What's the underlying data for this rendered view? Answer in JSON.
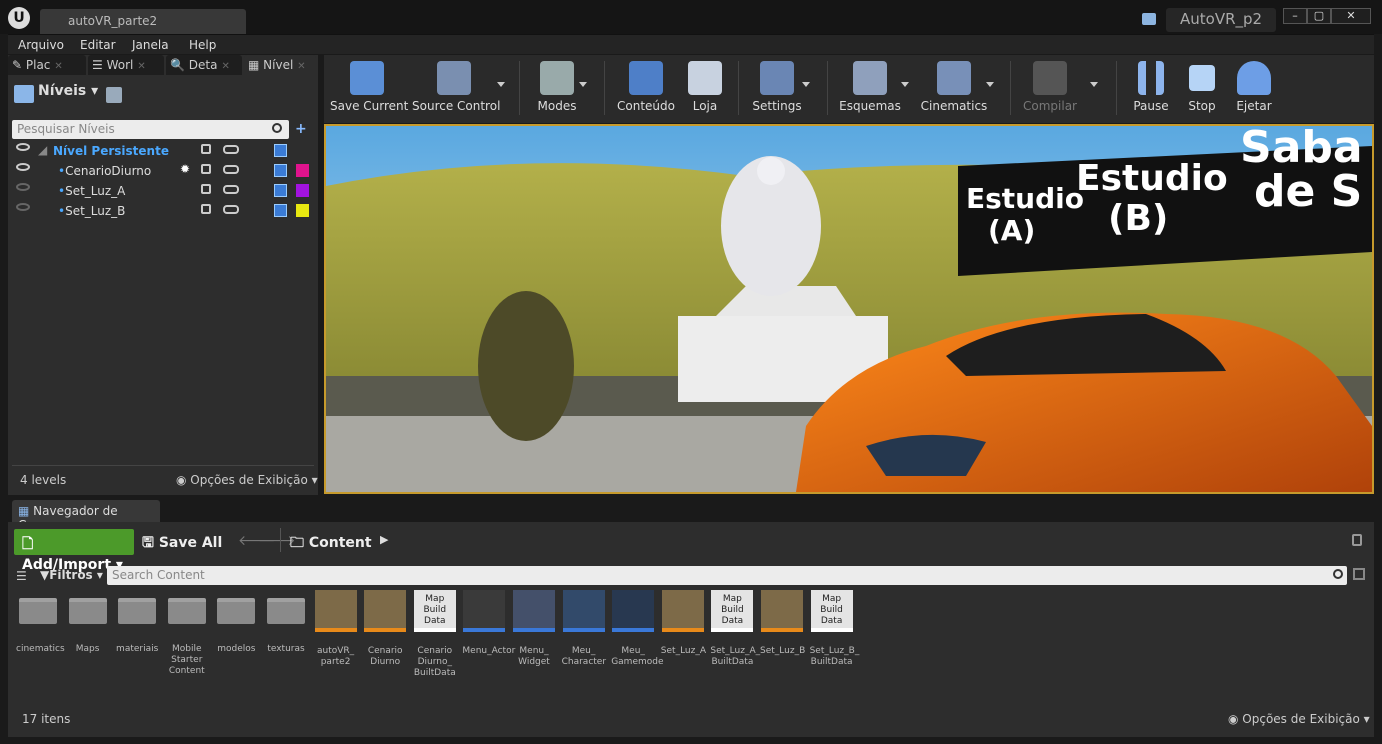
{
  "window": {
    "tab_title": "autoVR_parte2",
    "project_name": "AutoVR_p2"
  },
  "menu": [
    "Arquivo",
    "Editar",
    "Janela",
    "Help"
  ],
  "left_tabs": [
    "Plac",
    "Worl",
    "Deta",
    "Nível"
  ],
  "levels": {
    "header": "Níveis",
    "search_placeholder": "Pesquisar Níveis",
    "items": [
      {
        "name": "Nível Persistente",
        "color": ""
      },
      {
        "name": "CenarioDiurno",
        "color": "#e0138d"
      },
      {
        "name": "Set_Luz_A",
        "color": "#a213e0"
      },
      {
        "name": "Set_Luz_B",
        "color": "#e8e811"
      }
    ],
    "count": "4 levels",
    "view_options": "Opções de Exibição"
  },
  "toolbar": [
    "Save Current",
    "Source Control",
    "Modes",
    "Conteúdo",
    "Loja",
    "Settings",
    "Esquemas",
    "Cinematics",
    "Compilar",
    "Pause",
    "Stop",
    "Ejetar"
  ],
  "viewport": {
    "sign_a_1": "Estudio",
    "sign_a_2": "(A)",
    "sign_b_1": "Estudio",
    "sign_b_2": "(B)",
    "sign_c_1": "Saba",
    "sign_c_2": "de S"
  },
  "content_browser": {
    "tab": "Navegador de Con",
    "add_import": "Add/Import",
    "save_all": "Save All",
    "path": "Content",
    "filters": "Filtros",
    "search_placeholder": "Search Content",
    "assets": [
      {
        "label": "cinematics",
        "kind": "folder"
      },
      {
        "label": "Maps",
        "kind": "folder"
      },
      {
        "label": "materiais",
        "kind": "folder"
      },
      {
        "label": "Mobile Starter Content",
        "kind": "folder"
      },
      {
        "label": "modelos",
        "kind": "folder"
      },
      {
        "label": "texturas",
        "kind": "folder"
      },
      {
        "label": "autoVR_ parte2",
        "kind": "map"
      },
      {
        "label": "Cenario Diurno",
        "kind": "map"
      },
      {
        "label": "Cenario Diurno_ BuiltData",
        "kind": "builtdata"
      },
      {
        "label": "Menu_Actor",
        "kind": "actor"
      },
      {
        "label": "Menu_ Widget",
        "kind": "widget"
      },
      {
        "label": "Meu_ Character",
        "kind": "character"
      },
      {
        "label": "Meu_ Gamemode",
        "kind": "gamemode"
      },
      {
        "label": "Set_Luz_A",
        "kind": "map"
      },
      {
        "label": "Set_Luz_A_ BuiltData",
        "kind": "builtdata"
      },
      {
        "label": "Set_Luz_B",
        "kind": "map"
      },
      {
        "label": "Set_Luz_B_ BuiltData",
        "kind": "builtdata"
      }
    ],
    "builtdata_label": "Map Build Data",
    "item_count": "17 itens",
    "view_options": "Opções de Exibição"
  }
}
